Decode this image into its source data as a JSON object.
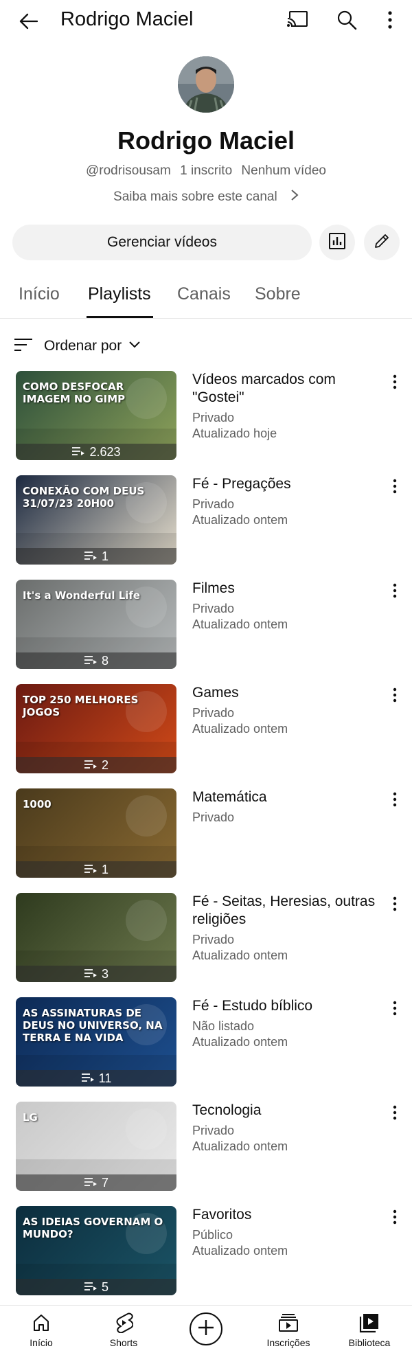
{
  "header": {
    "title": "Rodrigo Maciel"
  },
  "channel": {
    "name": "Rodrigo Maciel",
    "handle": "@rodrisousam",
    "subscribers": "1 inscrito",
    "videos": "Nenhum vídeo",
    "about_link": "Saiba mais sobre este canal"
  },
  "actions": {
    "manage_label": "Gerenciar vídeos"
  },
  "tabs": [
    {
      "label": "Início"
    },
    {
      "label": "Playlists"
    },
    {
      "label": "Canais"
    },
    {
      "label": "Sobre"
    }
  ],
  "active_tab": "Playlists",
  "sort": {
    "label": "Ordenar por"
  },
  "playlists": [
    {
      "title": "Vídeos marcados com \"Gostei\"",
      "privacy": "Privado",
      "updated": "Atualizado hoje",
      "count": "2.623",
      "thumb_text": "COMO DESFOCAR IMAGEM NO GIMP",
      "thumb_colors": [
        "#2d4f3a",
        "#8fa35b"
      ]
    },
    {
      "title": "Fé - Pregações",
      "privacy": "Privado",
      "updated": "Atualizado ontem",
      "count": "1",
      "thumb_text": "CONEXÃO COM DEUS 31/07/23 20H00",
      "thumb_colors": [
        "#1c2940",
        "#e9e1cf"
      ]
    },
    {
      "title": "Filmes",
      "privacy": "Privado",
      "updated": "Atualizado ontem",
      "count": "8",
      "thumb_text": "It's a Wonderful Life",
      "thumb_colors": [
        "#6a6d6c",
        "#b8bcbd"
      ]
    },
    {
      "title": "Games",
      "privacy": "Privado",
      "updated": "Atualizado ontem",
      "count": "2",
      "thumb_text": "TOP 250 MELHORES JOGOS",
      "thumb_colors": [
        "#6b1a12",
        "#d14a18"
      ]
    },
    {
      "title": "Matemática",
      "privacy": "Privado",
      "updated": "",
      "count": "1",
      "thumb_text": "1000",
      "thumb_colors": [
        "#4a3a1c",
        "#8a6a32"
      ]
    },
    {
      "title": "Fé - Seitas, Heresias, outras religiões",
      "privacy": "Privado",
      "updated": "Atualizado ontem",
      "count": "3",
      "thumb_text": "",
      "thumb_colors": [
        "#2e3a1e",
        "#6e7a4e"
      ]
    },
    {
      "title": "Fé - Estudo bíblico",
      "privacy": "Não listado",
      "updated": "Atualizado ontem",
      "count": "11",
      "thumb_text": "AS ASSINATURAS DE DEUS NO UNIVERSO, NA TERRA E NA VIDA",
      "thumb_colors": [
        "#0d2a55",
        "#1d4f8f"
      ]
    },
    {
      "title": "Tecnologia",
      "privacy": "Privado",
      "updated": "Atualizado ontem",
      "count": "7",
      "thumb_text": "LG",
      "thumb_colors": [
        "#c9c9c9",
        "#e9e9e9"
      ]
    },
    {
      "title": "Favoritos",
      "privacy": "Público",
      "updated": "Atualizado ontem",
      "count": "5",
      "thumb_text": "AS IDEIAS GOVERNAM O MUNDO?",
      "thumb_colors": [
        "#0c2d3d",
        "#1b5466"
      ]
    }
  ],
  "bottom_nav": [
    {
      "label": "Início",
      "icon": "home-icon"
    },
    {
      "label": "Shorts",
      "icon": "shorts-icon"
    },
    {
      "label": "",
      "icon": "create-icon"
    },
    {
      "label": "Inscrições",
      "icon": "subscriptions-icon"
    },
    {
      "label": "Biblioteca",
      "icon": "library-icon"
    }
  ]
}
